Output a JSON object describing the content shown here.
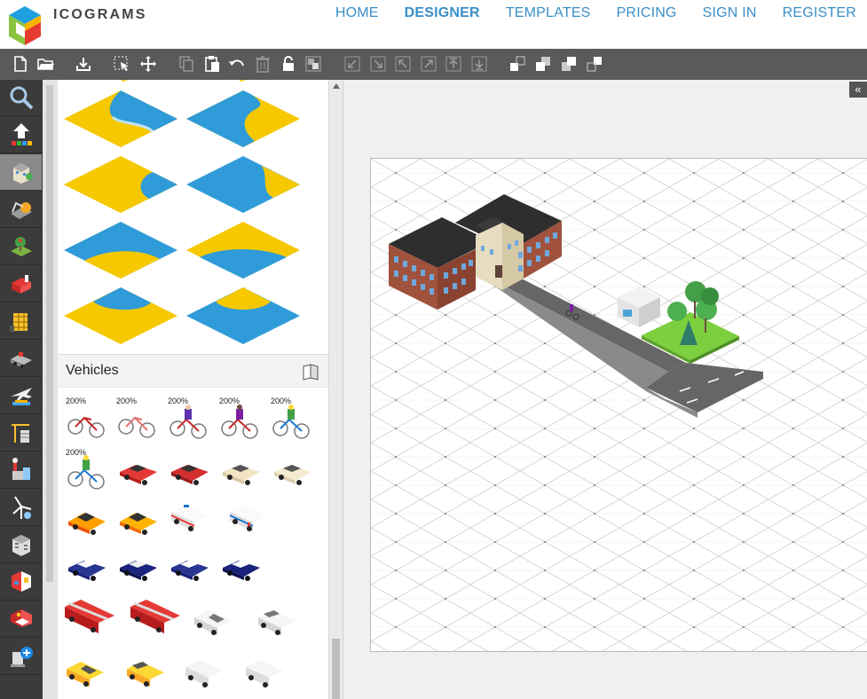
{
  "app": {
    "logo_text": "ICOGRAMS"
  },
  "nav": {
    "items": [
      "HOME",
      "DESIGNER",
      "TEMPLATES",
      "PRICING",
      "SIGN IN",
      "REGISTER"
    ],
    "active": "DESIGNER"
  },
  "toolbar": {
    "tools": [
      "new-file",
      "open-folder",
      "save-download",
      "select",
      "move",
      "copy",
      "paste",
      "undo",
      "delete",
      "lock",
      "group",
      "align-bottom-left",
      "align-bottom-right",
      "align-top-left",
      "align-top-right",
      "move-up",
      "move-down",
      "bring-to-front",
      "bring-forward",
      "send-backward",
      "send-to-back"
    ]
  },
  "sidebar": {
    "categories": [
      "search",
      "arrows",
      "buildings",
      "construction",
      "nature",
      "shop",
      "building-cranes",
      "vehicles",
      "airplane",
      "construction-tower",
      "factory",
      "windmill",
      "office",
      "interior",
      "bedroom",
      "medical"
    ],
    "active_index": 2
  },
  "library": {
    "section_title": "Vehicles",
    "badge": "200%",
    "colors": {
      "water": "#2f9bd8",
      "sand": "#f6c800"
    }
  },
  "canvas": {
    "collapse_label": "«"
  }
}
